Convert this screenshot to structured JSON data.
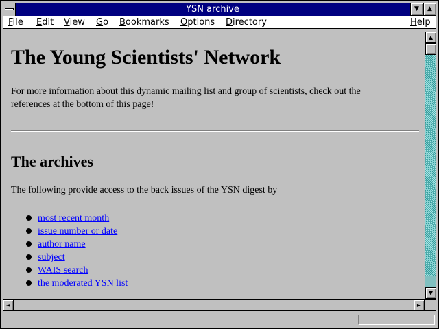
{
  "window": {
    "title": "YSN archive"
  },
  "menu": [
    {
      "label": "File"
    },
    {
      "label": "Edit"
    },
    {
      "label": "View"
    },
    {
      "label": "Go"
    },
    {
      "label": "Bookmarks"
    },
    {
      "label": "Options"
    },
    {
      "label": "Directory"
    },
    {
      "label": "Help"
    }
  ],
  "page": {
    "heading": "The Young Scientists' Network",
    "intro": "For more information about this dynamic mailing list and group of scientists, check out the references at the bottom of this page!",
    "archives_heading": "The archives",
    "archives_intro": "The following provide access to the back issues of the YSN digest by",
    "links": [
      {
        "label": "most recent month"
      },
      {
        "label": "issue number or date"
      },
      {
        "label": "author name"
      },
      {
        "label": "subject"
      },
      {
        "label": "WAIS search"
      },
      {
        "label": "the moderated YSN list"
      }
    ]
  },
  "status": {
    "text": ""
  },
  "icons": {
    "minimize": "down-triangle-icon",
    "maximize": "up-triangle-icon",
    "scroll_up": "up-arrow-icon",
    "scroll_down": "down-arrow-icon",
    "scroll_left": "left-arrow-icon",
    "scroll_right": "right-arrow-icon"
  },
  "colors": {
    "titlebar": "#000080",
    "link": "#0000ff",
    "background": "#c0c0c0"
  }
}
